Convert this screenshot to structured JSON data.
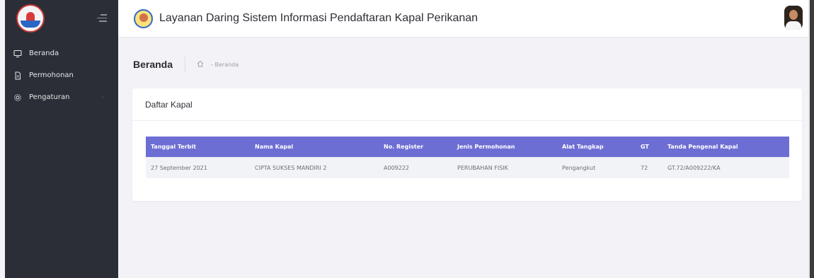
{
  "header": {
    "title": "Layanan Daring Sistem Informasi Pendaftaran Kapal Perikanan"
  },
  "sidebar": {
    "items": [
      {
        "label": "Beranda",
        "icon": "monitor-icon"
      },
      {
        "label": "Permohonan",
        "icon": "document-icon"
      },
      {
        "label": "Pengaturan",
        "icon": "gear-icon"
      }
    ]
  },
  "breadcrumb": {
    "page_title": "Beranda",
    "home_icon": "home-icon",
    "current": "- Beranda"
  },
  "card": {
    "title": "Daftar Kapal"
  },
  "table": {
    "headers": [
      "Tanggal Terbit",
      "Nama Kapal",
      "No. Register",
      "Jenis Permohonan",
      "Alat Tangkap",
      "GT",
      "Tanda Pengenal Kapal"
    ],
    "rows": [
      [
        "27 September 2021",
        "CIPTA SUKSES MANDIRI 2",
        "A009222",
        "PERUBAHAN FISIK",
        "Pengangkut",
        "72",
        "GT.72/A009222/KA"
      ]
    ]
  },
  "colors": {
    "sidebar_bg": "#2b2e36",
    "table_header_bg": "#6d6ed3",
    "page_bg": "#f3f3f7"
  }
}
